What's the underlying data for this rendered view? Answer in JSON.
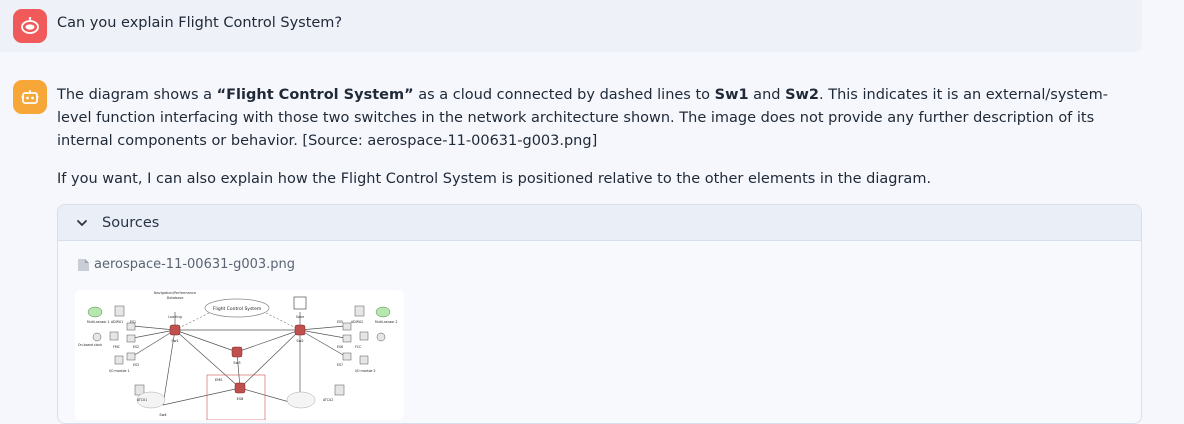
{
  "user_message": {
    "avatar_icon": "robot-face-icon",
    "avatar_color": "#f05a5a",
    "text": "Can you explain Flight Control System?"
  },
  "assistant_message": {
    "avatar_icon": "robot-icon",
    "avatar_color": "#f7a738",
    "p1_a": "The diagram shows a ",
    "p1_b": "“Flight Control System”",
    "p1_c": " as a cloud connected by dashed lines to ",
    "p1_d": "Sw1",
    "p1_e": " and ",
    "p1_f": "Sw2",
    "p1_g": ". This indicates it is an external/system-level function interfacing with those two switches in the network architecture shown. The image does not provide any further description of its internal components or behavior. [Source: aerospace-11-00631-g003.png]",
    "p2": "If you want, I can also explain how the Flight Control System is positioned relative to the other elements in the diagram."
  },
  "sources": {
    "title": "Sources",
    "expand_icon": "chevron-down-icon",
    "file_icon": "file-icon",
    "file_name": "aerospace-11-00631-g003.png",
    "thumbnail": {
      "top_label_1": "Navigation/Performance",
      "top_label_2": "Database",
      "cloud_label": "Flight Control System",
      "loading": "Loading",
      "save": "Save",
      "sw1": "Sw1",
      "sw2": "Sw2",
      "sw3": "Sw3",
      "multi1": "Multi-sensor 1",
      "multi2": "Multi-sensor 2",
      "adiru1": "ADIRU1",
      "adiru2": "ADIRU2",
      "es1": "ES1",
      "es2": "ES2",
      "es3": "ES3",
      "es5": "ES5",
      "es6": "ES6",
      "es7": "ES7",
      "es8": "ES8",
      "fmc": "FMC",
      "fcc": "FCC",
      "onboard_clock": "On-board clock",
      "io1": "I/O module 1",
      "io2": "I/O module 2",
      "atcu1": "ATCU1",
      "atcu2": "ATCU2",
      "ems": "EMS",
      "sw4": "Sw4"
    }
  }
}
